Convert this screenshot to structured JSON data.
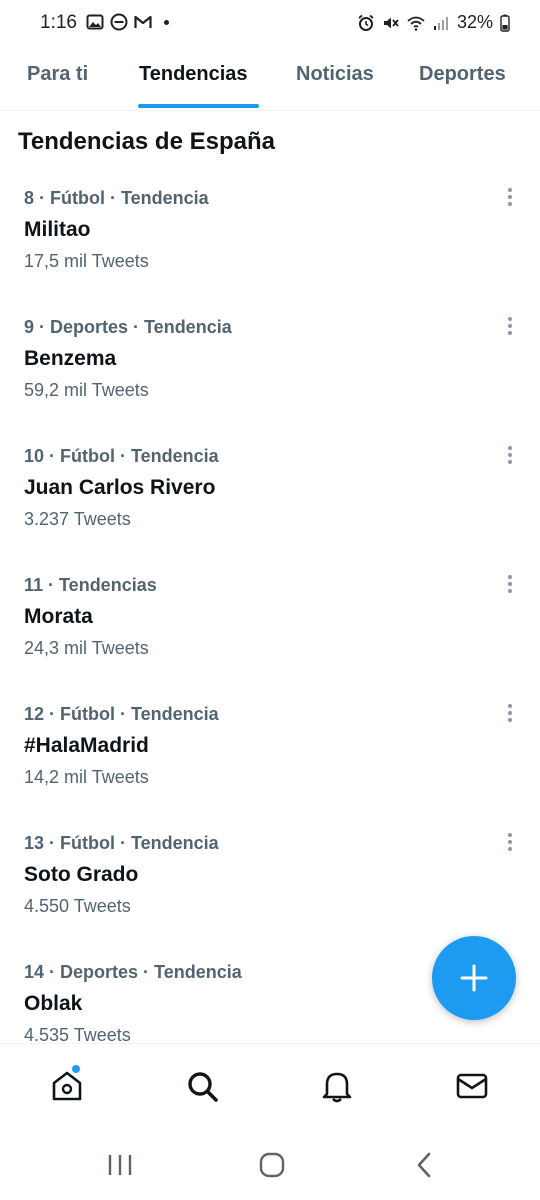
{
  "status_bar": {
    "time": "1:16",
    "battery": "32%"
  },
  "tabs": [
    {
      "label": "Para ti",
      "active": false
    },
    {
      "label": "Tendencias",
      "active": true
    },
    {
      "label": "Noticias",
      "active": false
    },
    {
      "label": "Deportes",
      "active": false
    }
  ],
  "section_title": "Tendencias de España",
  "trends": [
    {
      "meta": "8 · Fútbol · Tendencia",
      "name": "Militao",
      "count": "17,5 mil Tweets"
    },
    {
      "meta": "9 · Deportes · Tendencia",
      "name": "Benzema",
      "count": "59,2 mil Tweets"
    },
    {
      "meta": "10 · Fútbol · Tendencia",
      "name": "Juan Carlos Rivero",
      "count": "3.237 Tweets"
    },
    {
      "meta": "11 · Tendencias",
      "name": "Morata",
      "count": "24,3 mil Tweets"
    },
    {
      "meta": "12 · Fútbol · Tendencia",
      "name": "#HalaMadrid",
      "count": "14,2 mil Tweets"
    },
    {
      "meta": "13 · Fútbol · Tendencia",
      "name": "Soto Grado",
      "count": "4.550 Tweets"
    },
    {
      "meta": "14 · Deportes · Tendencia",
      "name": "Oblak",
      "count": "4.535 Tweets"
    }
  ],
  "icons": {
    "home": "home-icon",
    "search": "search-icon",
    "notifications": "bell-icon",
    "messages": "mail-icon",
    "compose": "plus-icon"
  },
  "colors": {
    "accent": "#1d9bf0",
    "text_primary": "#0f1419",
    "text_secondary": "#536471"
  }
}
